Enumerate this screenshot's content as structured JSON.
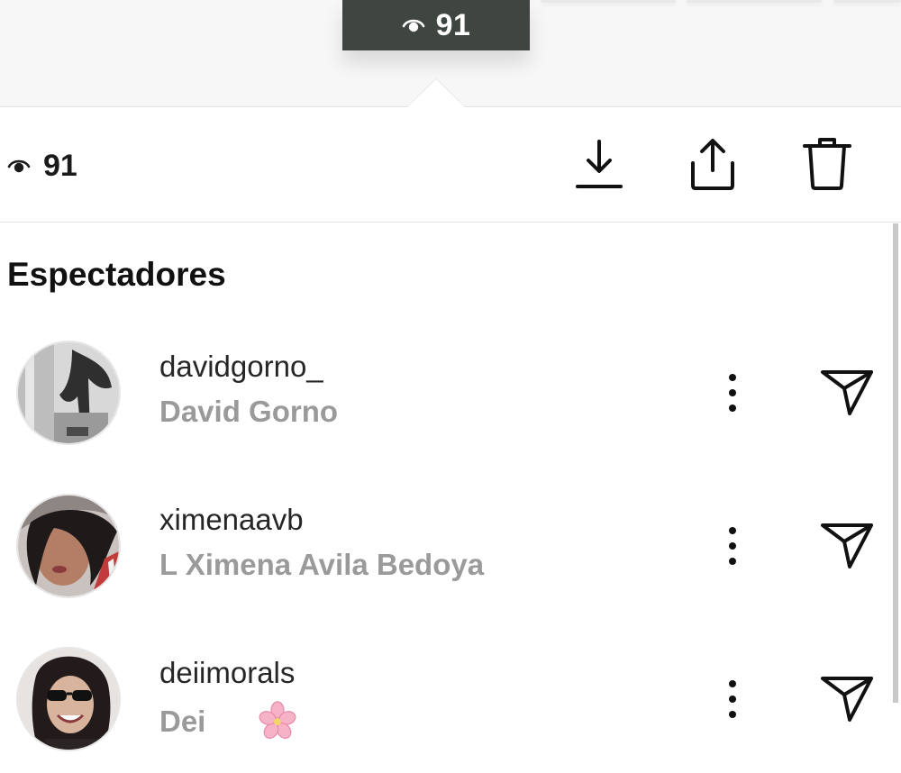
{
  "story_header": {
    "view_count": "91"
  },
  "action_bar": {
    "view_count": "91",
    "icons": [
      "eye-icon",
      "download-icon",
      "share-icon",
      "trash-icon"
    ]
  },
  "viewers_section": {
    "title": "Espectadores",
    "viewers": [
      {
        "username": "davidgorno_",
        "full_name": "David Gorno",
        "emoji": ""
      },
      {
        "username": "ximenaavb",
        "full_name": "L Ximena Avila Bedoya",
        "emoji": ""
      },
      {
        "username": "deiimorals",
        "full_name": "Dei",
        "emoji": "🌸"
      }
    ]
  },
  "colors": {
    "pill_bg": "#3f4540",
    "secondary_text": "#9a9a9a",
    "primary_text": "#262626"
  }
}
